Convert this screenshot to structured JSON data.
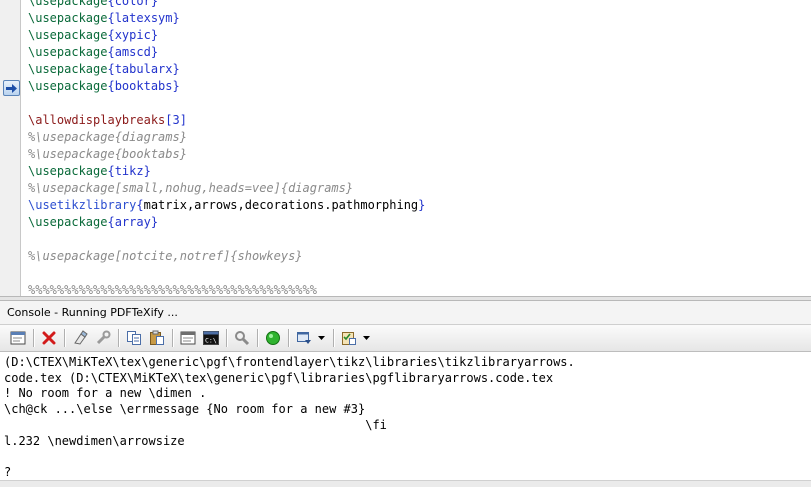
{
  "editor": {
    "lines": [
      [
        {
          "c": "cmd",
          "t": "\\usepackage"
        },
        {
          "c": "arg",
          "t": "{color}"
        }
      ],
      [
        {
          "c": "cmd",
          "t": "\\usepackage"
        },
        {
          "c": "arg",
          "t": "{latexsym}"
        }
      ],
      [
        {
          "c": "cmd",
          "t": "\\usepackage"
        },
        {
          "c": "arg",
          "t": "{xypic}"
        }
      ],
      [
        {
          "c": "cmd",
          "t": "\\usepackage"
        },
        {
          "c": "arg",
          "t": "{amscd}"
        }
      ],
      [
        {
          "c": "cmd",
          "t": "\\usepackage"
        },
        {
          "c": "arg",
          "t": "{tabularx}"
        }
      ],
      [
        {
          "c": "cmd",
          "t": "\\usepackage"
        },
        {
          "c": "arg",
          "t": "{booktabs}"
        }
      ],
      [],
      [
        {
          "c": "cmdb",
          "t": "\\allowdisplaybreaks"
        },
        {
          "c": "arg",
          "t": "[3]"
        }
      ],
      [
        {
          "c": "cmt",
          "t": "%\\usepackage{diagrams}"
        }
      ],
      [
        {
          "c": "cmt",
          "t": "%\\usepackage{booktabs}"
        }
      ],
      [
        {
          "c": "cmd",
          "t": "\\usepackage"
        },
        {
          "c": "arg",
          "t": "{tikz}"
        }
      ],
      [
        {
          "c": "cmt",
          "t": "%\\usepackage[small,nohug,heads=vee]{diagrams}"
        }
      ],
      [
        {
          "c": "cmdl",
          "t": "\\usetikzlibrary"
        },
        {
          "c": "arg",
          "t": "{"
        },
        {
          "c": "txt",
          "t": "matrix,arrows,decorations.pathmorphing"
        },
        {
          "c": "arg",
          "t": "}"
        }
      ],
      [
        {
          "c": "cmd",
          "t": "\\usepackage"
        },
        {
          "c": "arg",
          "t": "{array}"
        }
      ],
      [],
      [
        {
          "c": "cmt",
          "t": "%\\usepackage[notcite,notref]{showkeys}"
        }
      ],
      [],
      [
        {
          "c": "sep",
          "t": "%%%%%%%%%%%%%%%%%%%%%%%%%%%%%%%%%%%%%%%%"
        }
      ]
    ],
    "bookmark_line": 5
  },
  "console": {
    "title": "Console - Running PDFTeXify ...",
    "toolbar": [
      "console-window-icon",
      "stop-icon",
      "clear-icon",
      "options-icon",
      "copy-icon",
      "paste-icon",
      "log-icon",
      "command-prompt-icon",
      "find-icon",
      "go-icon",
      "output-profile-icon",
      "dropdown-icon",
      "checklist-icon",
      "dropdown-icon"
    ],
    "output": [
      "(D:\\CTEX\\MiKTeX\\tex\\generic\\pgf\\frontendlayer\\tikz\\libraries\\tikzlibraryarrows.",
      "code.tex (D:\\CTEX\\MiKTeX\\tex\\generic\\pgf\\libraries\\pgflibraryarrows.code.tex",
      "! No room for a new \\dimen .",
      "\\ch@ck ...\\else \\errmessage {No room for a new #3}",
      "                                                  \\fi",
      "l.232 \\newdimen\\arrowsize",
      "",
      "?"
    ]
  }
}
